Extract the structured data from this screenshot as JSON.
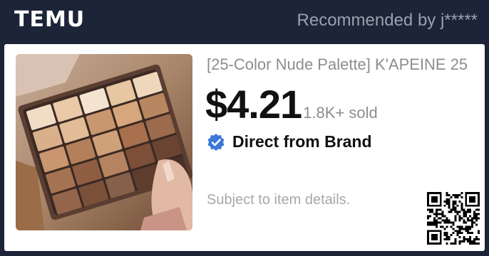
{
  "header": {
    "logo": "TEMU",
    "recommended": "Recommended by j*****"
  },
  "product": {
    "title": "[25-Color Nude Palette] K'APEINE 25",
    "price": "$4.21",
    "sold": "1.8K+ sold",
    "brand_badge": "Direct from Brand",
    "subject_note": "Subject to item details."
  },
  "icons": {
    "verified": "verified-check-icon",
    "qr": "qr-code"
  },
  "colors": {
    "header_bg": "#1c2437",
    "card_bg": "#ffffff",
    "verified_blue": "#3d77d9",
    "price_text": "#111111",
    "muted_text": "#8d8d8d"
  }
}
